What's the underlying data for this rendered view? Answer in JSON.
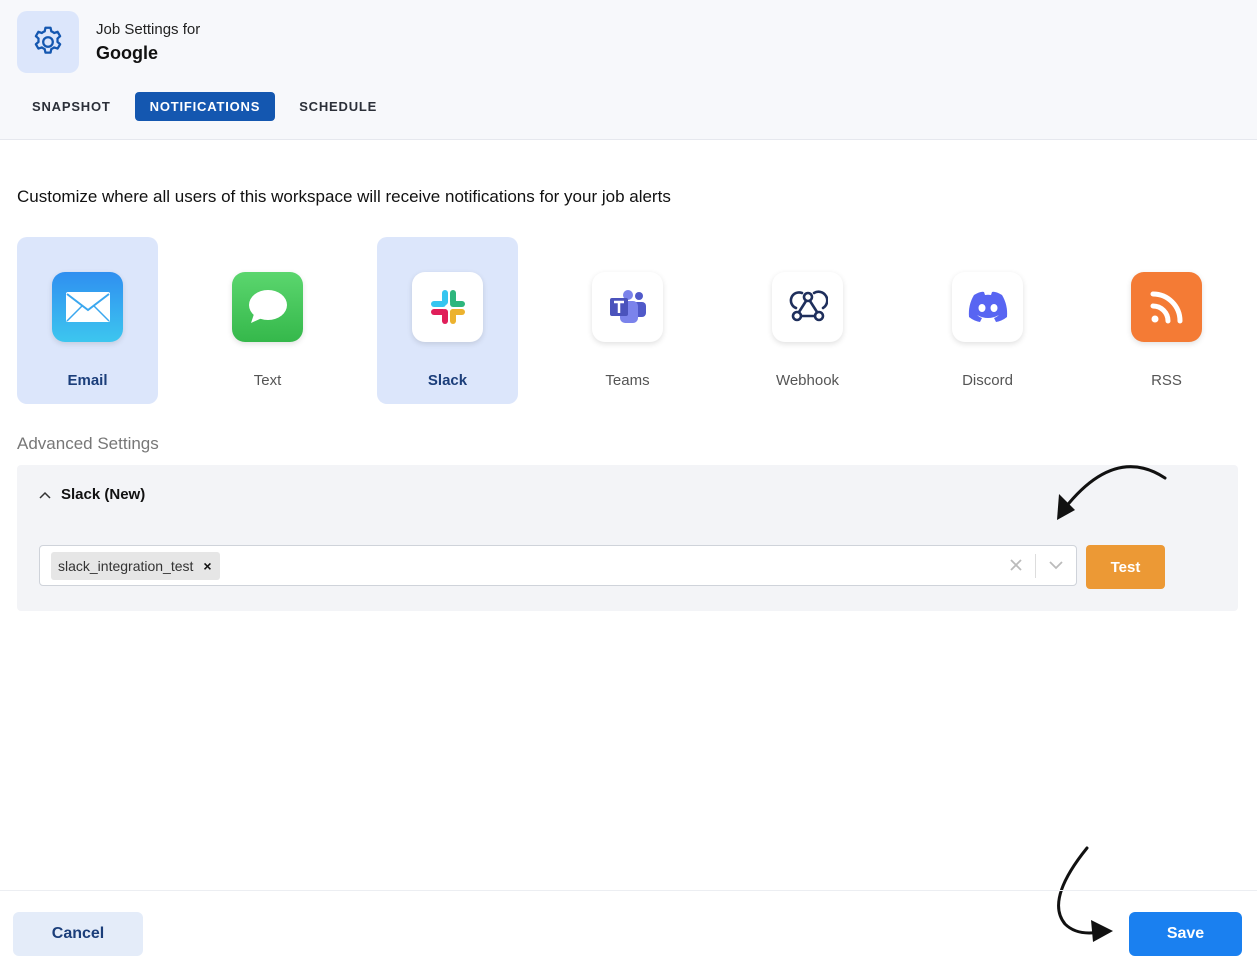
{
  "header": {
    "subtitle": "Job Settings for",
    "title": "Google",
    "tabs": [
      {
        "label": "SNAPSHOT",
        "active": false
      },
      {
        "label": "NOTIFICATIONS",
        "active": true
      },
      {
        "label": "SCHEDULE",
        "active": false
      }
    ]
  },
  "description": "Customize where all users of this workspace will receive notifications for your job alerts",
  "channels": [
    {
      "label": "Email",
      "selected": true,
      "icon": "envelope-icon"
    },
    {
      "label": "Text",
      "selected": false,
      "icon": "message-bubble-icon"
    },
    {
      "label": "Slack",
      "selected": true,
      "icon": "slack-icon"
    },
    {
      "label": "Teams",
      "selected": false,
      "icon": "teams-icon"
    },
    {
      "label": "Webhook",
      "selected": false,
      "icon": "webhook-icon"
    },
    {
      "label": "Discord",
      "selected": false,
      "icon": "discord-icon"
    },
    {
      "label": "RSS",
      "selected": false,
      "icon": "rss-icon"
    }
  ],
  "advanced": {
    "title": "Advanced Settings",
    "section_label": "Slack (New)",
    "selected_chip": "slack_integration_test",
    "chip_remove": "×",
    "test_label": "Test"
  },
  "footer": {
    "cancel_label": "Cancel",
    "save_label": "Save"
  },
  "colors": {
    "accent_blue": "#1457b0",
    "save_blue": "#1a80f0",
    "test_orange": "#ec9935",
    "selected_tile": "#dce6fb"
  }
}
